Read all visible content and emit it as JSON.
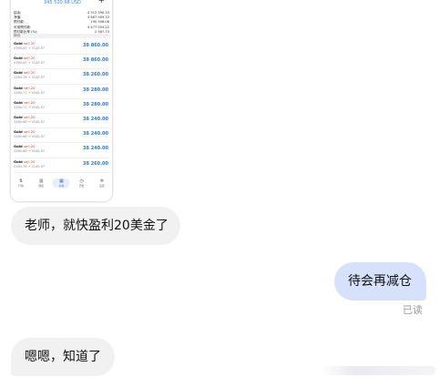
{
  "trade_screenshot": {
    "balance_header": "345 520.98 USD",
    "summary": [
      {
        "label": "结余:",
        "value": "4 312 390.33"
      },
      {
        "label": "净值:",
        "value": "4 667 909.33"
      },
      {
        "label": "预付款:",
        "value": "190 906.06"
      },
      {
        "label": "可用预付款:",
        "value": "4 477 003.22"
      },
      {
        "label": "预付款比率 (%):",
        "value": "2 587.73"
      }
    ],
    "section_label": "持仓",
    "positions": [
      {
        "symbol": "Gold",
        "side": "sell 20",
        "prices": "4169.00 → 4145.97",
        "profit": "38 860.00"
      },
      {
        "symbol": "Gold",
        "side": "sell 20",
        "prices": "4169.00 → 4145.97",
        "profit": "38 860.00"
      },
      {
        "symbol": "Gold",
        "side": "sell 20",
        "prices": "4164.78 → 4145.97",
        "profit": "38 260.00"
      },
      {
        "symbol": "Gold",
        "side": "sell 20",
        "prices": "4164.71 → 4145.97",
        "profit": "38 280.00"
      },
      {
        "symbol": "Gold",
        "side": "sell 20",
        "prices": "4164.71 → 4145.97",
        "profit": "38 280.00"
      },
      {
        "symbol": "Gold",
        "side": "sell 20",
        "prices": "4164.68 → 4145.97",
        "profit": "38 240.00"
      },
      {
        "symbol": "Gold",
        "side": "sell 20",
        "prices": "4164.68 → 4145.97",
        "profit": "38 240.00"
      },
      {
        "symbol": "Gold",
        "side": "sell 20",
        "prices": "4164.68 → 4145.97",
        "profit": "38 240.00"
      },
      {
        "symbol": "Gold",
        "side": "sell 20",
        "prices": "4164.78 → 4145.97",
        "profit": "38 260.00"
      }
    ],
    "nav": [
      {
        "icon": "arrows-icon",
        "glyph": "⇅",
        "label": "行情"
      },
      {
        "icon": "chart-icon",
        "glyph": "▥",
        "label": "图表"
      },
      {
        "icon": "trade-icon",
        "glyph": "▦",
        "label": "交易",
        "active": true
      },
      {
        "icon": "history-icon",
        "glyph": "◷",
        "label": "历史"
      },
      {
        "icon": "settings-icon",
        "glyph": "✲",
        "label": "设置"
      }
    ]
  },
  "messages": [
    {
      "id": "m1",
      "direction": "incoming",
      "text": "老师，就快盈利20美金了"
    },
    {
      "id": "m2",
      "direction": "outgoing",
      "text": "待会再减仓",
      "status": "已读"
    },
    {
      "id": "m3",
      "direction": "incoming",
      "text": "嗯嗯，知道了"
    }
  ],
  "colors": {
    "incoming_bubble": "#f1f1f2",
    "outgoing_bubble": "#d6e2fc",
    "profit_blue": "#2f7bdc",
    "sell_red": "#d9343a"
  }
}
